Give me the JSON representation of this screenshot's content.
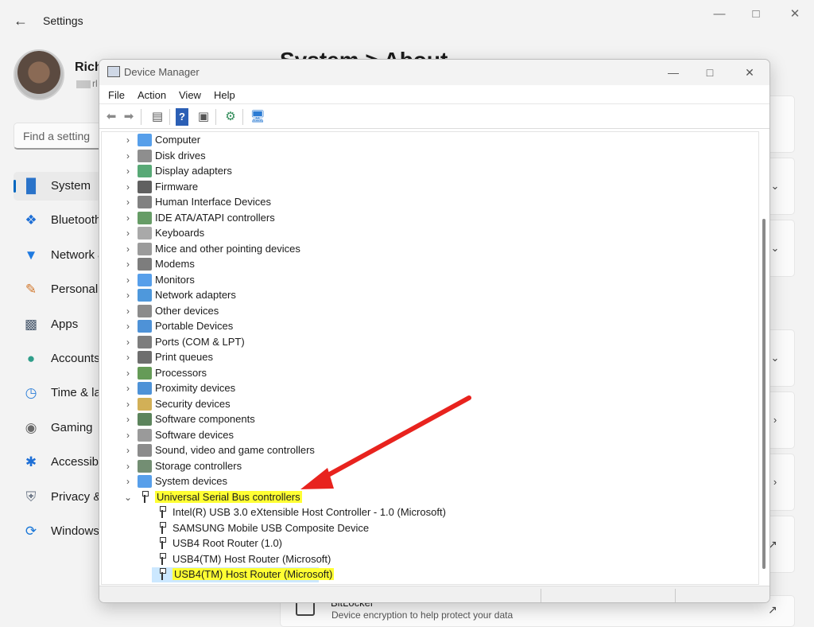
{
  "settings": {
    "title": "Settings",
    "user": {
      "name": "Rich",
      "email_fragment": "rl"
    },
    "search_placeholder": "Find a setting",
    "heading_peek": "System > About",
    "nav": [
      {
        "label": "System",
        "icon": "monitor-icon",
        "active": true
      },
      {
        "label": "Bluetooth & devices",
        "icon": "bluetooth-icon"
      },
      {
        "label": "Network & internet",
        "icon": "wifi-icon"
      },
      {
        "label": "Personalization",
        "icon": "brush-icon"
      },
      {
        "label": "Apps",
        "icon": "apps-icon"
      },
      {
        "label": "Accounts",
        "icon": "person-icon"
      },
      {
        "label": "Time & language",
        "icon": "clock-globe-icon"
      },
      {
        "label": "Gaming",
        "icon": "gamepad-icon"
      },
      {
        "label": "Accessibility",
        "icon": "accessibility-icon"
      },
      {
        "label": "Privacy & security",
        "icon": "shield-icon"
      },
      {
        "label": "Windows Update",
        "icon": "update-icon"
      }
    ],
    "bitlocker": {
      "title": "BitLocker",
      "description": "Device encryption to help protect your data"
    }
  },
  "device_manager": {
    "title": "Device Manager",
    "menu": [
      "File",
      "Action",
      "View",
      "Help"
    ],
    "categories": [
      {
        "label": "Computer",
        "icon": "computer-icon"
      },
      {
        "label": "Disk drives",
        "icon": "disk-drive-icon"
      },
      {
        "label": "Display adapters",
        "icon": "display-adapter-icon"
      },
      {
        "label": "Firmware",
        "icon": "firmware-icon"
      },
      {
        "label": "Human Interface Devices",
        "icon": "hid-icon"
      },
      {
        "label": "IDE ATA/ATAPI controllers",
        "icon": "ide-controller-icon"
      },
      {
        "label": "Keyboards",
        "icon": "keyboard-icon"
      },
      {
        "label": "Mice and other pointing devices",
        "icon": "mouse-icon"
      },
      {
        "label": "Modems",
        "icon": "modem-icon"
      },
      {
        "label": "Monitors",
        "icon": "monitor-icon"
      },
      {
        "label": "Network adapters",
        "icon": "network-adapter-icon"
      },
      {
        "label": "Other devices",
        "icon": "other-devices-icon"
      },
      {
        "label": "Portable Devices",
        "icon": "portable-device-icon"
      },
      {
        "label": "Ports (COM & LPT)",
        "icon": "port-icon"
      },
      {
        "label": "Print queues",
        "icon": "printer-icon"
      },
      {
        "label": "Processors",
        "icon": "processor-icon"
      },
      {
        "label": "Proximity devices",
        "icon": "proximity-icon"
      },
      {
        "label": "Security devices",
        "icon": "security-device-icon"
      },
      {
        "label": "Software components",
        "icon": "software-component-icon"
      },
      {
        "label": "Software devices",
        "icon": "software-device-icon"
      },
      {
        "label": "Sound, video and game controllers",
        "icon": "speaker-icon"
      },
      {
        "label": "Storage controllers",
        "icon": "storage-controller-icon"
      },
      {
        "label": "System devices",
        "icon": "system-device-icon"
      },
      {
        "label": "Universal Serial Bus controllers",
        "icon": "usb-icon",
        "expanded": true,
        "highlighted": true
      }
    ],
    "usb_children": [
      {
        "label": "Intel(R) USB 3.0 eXtensible Host Controller - 1.0 (Microsoft)"
      },
      {
        "label": "SAMSUNG Mobile USB Composite Device"
      },
      {
        "label": "USB4 Root Router (1.0)"
      },
      {
        "label": "USB4(TM) Host Router (Microsoft)"
      },
      {
        "label": "USB4(TM) Host Router (Microsoft)",
        "selected": true,
        "highlighted": true
      }
    ]
  },
  "colors": {
    "accent": "#0067c0",
    "highlight": "#ffff33",
    "selection": "#cce8ff",
    "arrow": "#e8231e"
  }
}
